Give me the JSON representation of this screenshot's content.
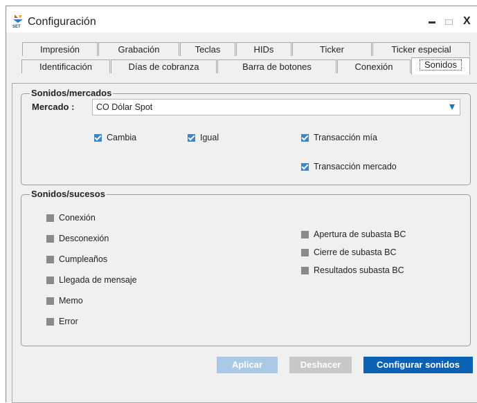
{
  "window": {
    "title": "Configuración"
  },
  "tabs_row1": [
    {
      "label": "Impresión",
      "u": ""
    },
    {
      "label": "Grabación",
      "u": "G"
    },
    {
      "label": "Teclas",
      "u": "T"
    },
    {
      "label": "HIDs",
      "u": ""
    },
    {
      "label": "Ticker",
      "u": "k"
    },
    {
      "label": "Ticker especial",
      "u": ""
    }
  ],
  "tabs_row2": [
    {
      "label": "Identificación",
      "u": "I"
    },
    {
      "label": "Días de cobranza",
      "u": ""
    },
    {
      "label": "Barra de botones",
      "u": "B"
    },
    {
      "label": "Conexión",
      "u": "x"
    },
    {
      "label": "Sonidos",
      "u": "S",
      "active": true
    }
  ],
  "markets_group": {
    "legend": "Sonidos/mercados",
    "market_label": "Mercado :",
    "market_value": "CO Dólar Spot",
    "checks": [
      {
        "label": "Cambia",
        "checked": true
      },
      {
        "label": "Igual",
        "checked": true
      },
      {
        "label": "Transacción mía",
        "checked": true
      },
      {
        "label": "Transacción mercado",
        "checked": true
      }
    ]
  },
  "events_group": {
    "legend": "Sonidos/sucesos",
    "left": [
      "Conexión",
      "Desconexión",
      "Cumpleaños",
      "Llegada de mensaje",
      "Memo",
      "Error"
    ],
    "right": [
      "Apertura de subasta BC",
      "Cierre de subasta BC",
      "Resultados subasta BC"
    ]
  },
  "buttons": {
    "apply": "Aplicar",
    "undo": "Deshacer",
    "configure": "Configurar sonidos"
  },
  "colors": {
    "accent": "#0b62b5",
    "check": "#3d86c6",
    "disabled": "#a9c9e6"
  }
}
